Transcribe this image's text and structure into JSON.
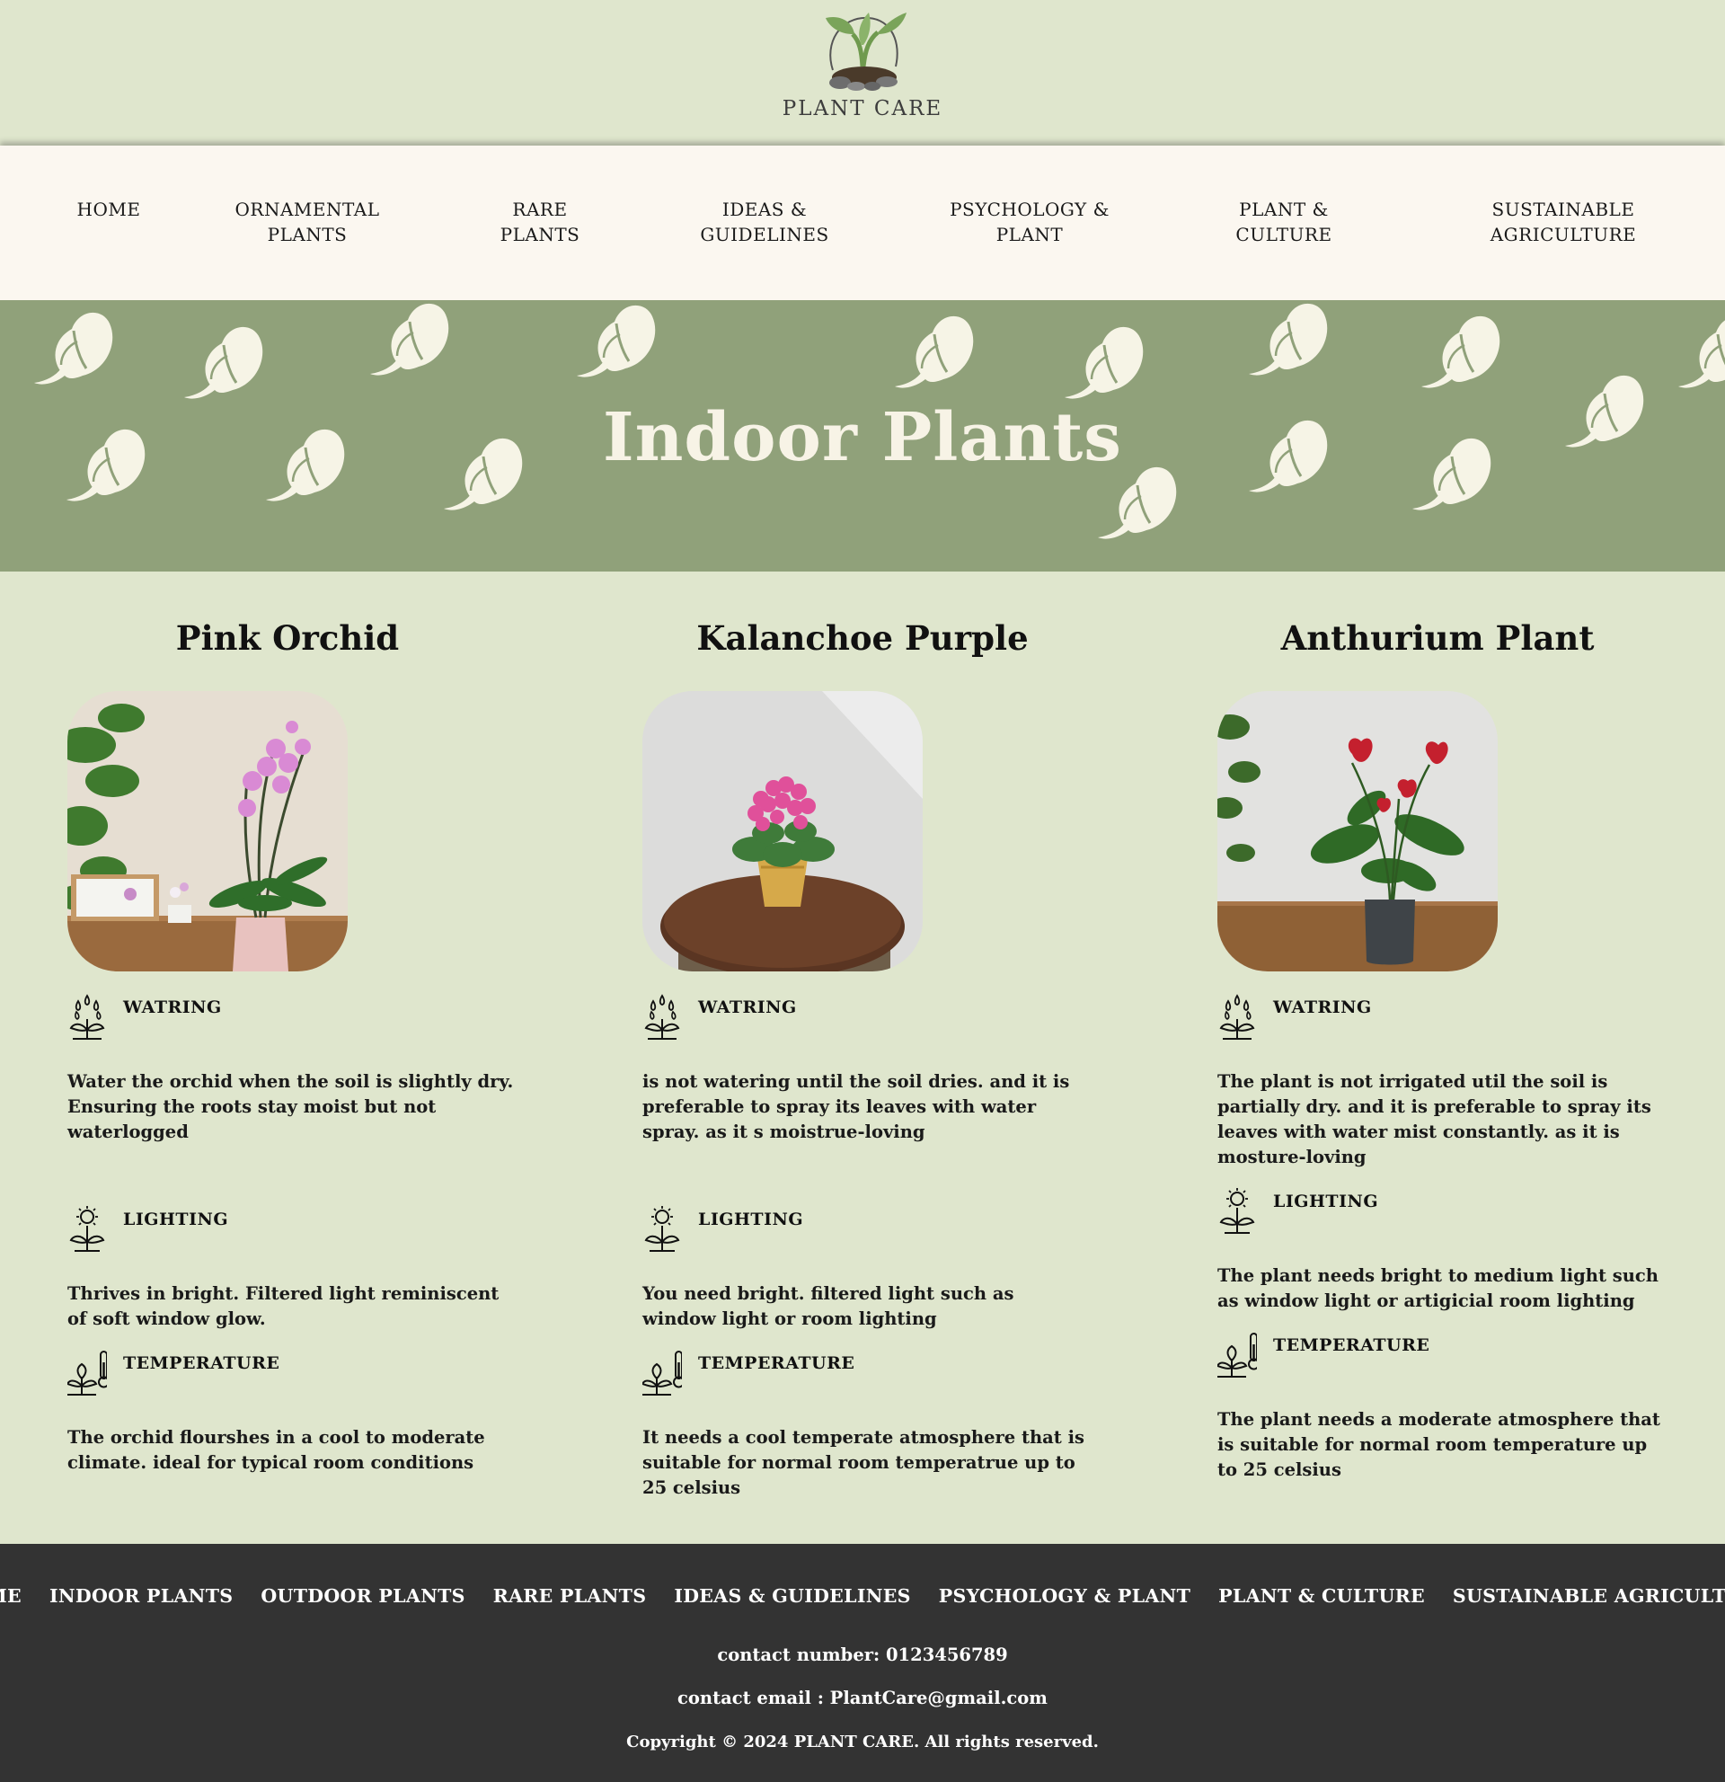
{
  "header": {
    "brand_name": "PLANT CARE",
    "logo_icon": "sprout-logo-icon"
  },
  "nav": {
    "items": [
      {
        "line1": "HOME",
        "line2": ""
      },
      {
        "line1": "ORNAMENTAL",
        "line2": "PLANTS"
      },
      {
        "line1": "RARE",
        "line2": "PLANTS"
      },
      {
        "line1": "IDEAS &",
        "line2": "GUIDELINES"
      },
      {
        "line1": "PSYCHOLOGY &",
        "line2": "PLANT"
      },
      {
        "line1": "PLANT &",
        "line2": "CULTURE"
      },
      {
        "line1": "SUSTAINABLE",
        "line2": "AGRICULTURE"
      }
    ]
  },
  "hero": {
    "title": "Indoor Plants",
    "background_color": "#90a17a",
    "pattern_color": "#f6f4e6"
  },
  "plants": [
    {
      "name": "Pink Orchid",
      "watering_label": "WATRING",
      "watering_text": "Water the orchid when the soil is slightly dry. Ensuring the roots stay moist but not waterlogged",
      "lighting_label": "LIGHTING",
      "lighting_text": "Thrives in bright. Filtered light reminiscent of soft window glow.",
      "temperature_label": "TEMPERATURE",
      "temperature_text": "The orchid flourshes in a cool to moderate climate. ideal for typical room conditions"
    },
    {
      "name": "Kalanchoe Purple",
      "watering_label": "WATRING",
      "watering_text": "is not watering until the soil dries. and it is preferable to spray its leaves with water spray. as it s moistrue-loving",
      "lighting_label": "LIGHTING",
      "lighting_text": "You need bright. filtered light such as window light or room lighting",
      "temperature_label": "TEMPERATURE",
      "temperature_text": "It needs a cool temperate atmosphere that is suitable for normal room temperatrue up to 25 celsius"
    },
    {
      "name": "Anthurium Plant",
      "watering_label": "WATRING",
      "watering_text": "The plant is not irrigated util the soil is partially dry. and it is preferable to spray its leaves with water mist constantly. as it is mosture-loving",
      "lighting_label": "LIGHTING",
      "lighting_text": "The plant needs bright to medium light such as window light or artigicial room lighting",
      "temperature_label": "TEMPERATURE",
      "temperature_text": "The plant needs a moderate atmosphere that is suitable for normal room temperature up to 25 celsius"
    }
  ],
  "footer": {
    "links": [
      "HOME",
      "INDOOR PLANTS",
      "OUTDOOR PLANTS",
      "RARE PLANTS",
      "IDEAS & GUIDELINES",
      "PSYCHOLOGY & PLANT",
      "PLANT & CULTURE",
      "SUSTAINABLE AGRICULTURE"
    ],
    "contact_number": "contact number: 0123456789",
    "contact_email": "contact email : PlantCare@gmail.com",
    "copyright": "Copyright © 2024 PLANT CARE. All rights reserved."
  },
  "colors": {
    "page_background": "#dfe6cd",
    "nav_background": "#fbf7f0",
    "footer_background": "#333333"
  }
}
